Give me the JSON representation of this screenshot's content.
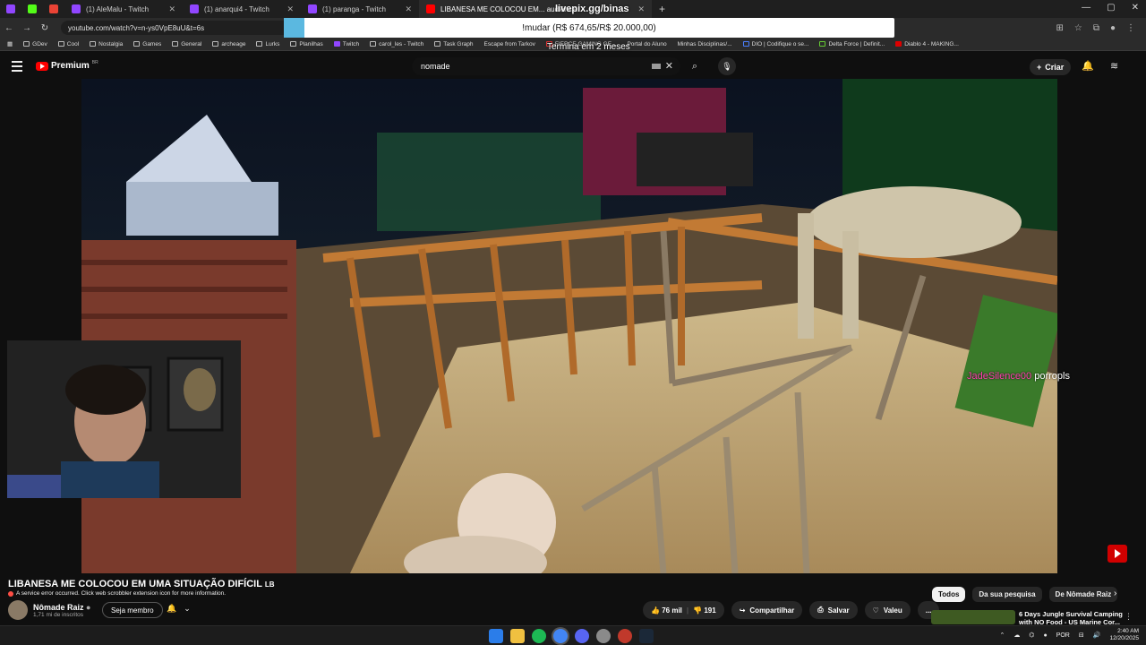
{
  "browser": {
    "tabs": [
      {
        "title": "",
        "kind": "pinned",
        "color": "#9146ff"
      },
      {
        "title": "",
        "kind": "pinned",
        "color": "#53fc18"
      },
      {
        "title": "",
        "kind": "pinned",
        "color": "#ea4335"
      },
      {
        "title": "(1) AleMalu - Twitch",
        "kind": "normal"
      },
      {
        "title": "(1) anarqui4 - Twitch",
        "kind": "normal"
      },
      {
        "title": "(1) paranga - Twitch",
        "kind": "normal"
      },
      {
        "title": "LIBANESA ME COLOCOU EM... audiência",
        "kind": "active"
      }
    ],
    "new_tab": "+",
    "url": "youtube.com/watch?v=n-ys0VpE8uU&t=6s",
    "bookmarks": [
      "GDev",
      "Cool",
      "Nostalgia",
      "Games",
      "General",
      "archeage",
      "Lurks",
      "Planilhas",
      "Twitch",
      "carol_les - Twitch",
      "Task Graph",
      "Escape from Tarkov",
      "FIERCE GAMING GE...",
      "Portal do Aluno",
      "Minhas Disciplinas/...",
      "DIO | Codifique o se...",
      "Delta Force | Definit...",
      "Diablo 4 - MAKING..."
    ]
  },
  "stream_overlay": {
    "title": "livepix.gg/binas",
    "goal": "!mudar (R$ 674,65/R$ 20.000,00)",
    "timer": "Termina em 2 meses"
  },
  "youtube": {
    "brand": "Premium",
    "region": "BR",
    "search_value": "nomade",
    "create_label": "Criar",
    "video": {
      "title": "LIBANESA ME COLOCOU EM UMA SITUAÇÃO DIFÍCIL",
      "title_suffix": "LB",
      "error": "A service error occurred. Click web scrobbler extension icon for more information.",
      "channel": "Nômade Raiz",
      "subscribers": "1,71 mi de inscritos",
      "join_label": "Seja membro",
      "likes": "76 mil",
      "dislikes": "191",
      "share_label": "Compartilhar",
      "save_label": "Salvar",
      "thanks_label": "Valeu",
      "more_label": "..."
    },
    "chips": [
      "Todos",
      "Da sua pesquisa",
      "De Nômade Raiz"
    ],
    "recommendation": {
      "title": "6 Days Jungle Survival Camping with NO Food - US Marine Cor..."
    }
  },
  "chat": {
    "user": "JadeSilence00",
    "message": "porropls"
  },
  "taskbar": {
    "lang": "POR",
    "time": "2:40 AM",
    "date": "12/20/2025"
  }
}
